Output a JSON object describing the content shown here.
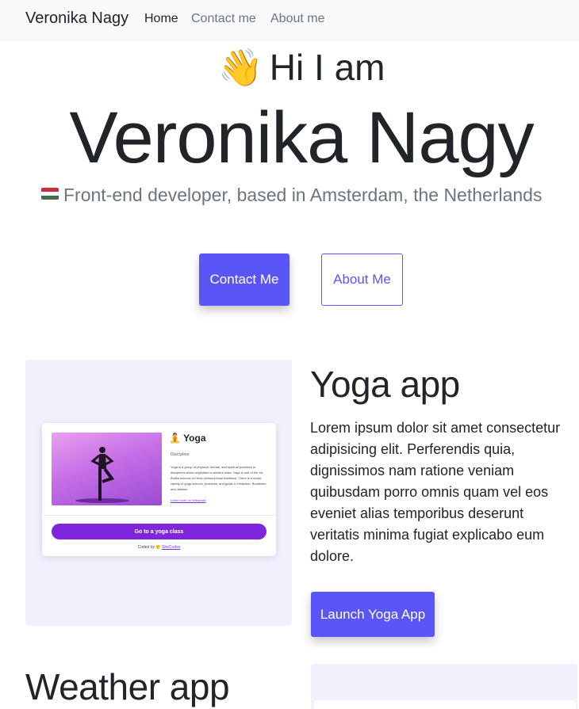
{
  "navbar": {
    "brand": "Veronika Nagy",
    "links": [
      "Home",
      "Contact me",
      "About me"
    ]
  },
  "hero": {
    "greeting": "Hi I am",
    "greeting_emoji": "👋",
    "name": "Veronika Nagy",
    "subtitle": "Front-end developer, based in Amsterdam, the Netherlands",
    "flag_colors": [
      "#cd2a3e",
      "#ffffff",
      "#436f4d"
    ],
    "contact_button": "Contact Me",
    "about_button": "About Me"
  },
  "projects": [
    {
      "title": "Yoga app",
      "description": "Lorem ipsum dolor sit amet consectetur adipisicing elit. Perferendis quia, dignissimos nam ratione veniam quibusdam porro omnis quam vel eos eveniet alias temporibus deserunt veritatis minima fugiat explicabo eum dolore.",
      "button": "Launch Yoga App",
      "preview": {
        "title": "Yoga",
        "subtitle": "Discipline",
        "text": "Yoga is a group of physical, mental, and spiritual practices or disciplines which originated in ancient India. Yoga is one of the six Āstika schools of Hindu philosophical traditions. There is a broad variety of yoga schools, practices, and goals in Hinduism, Buddhism, and Jainism.",
        "link": "Learn more on Wikipedia",
        "button": "Go to a yoga class",
        "credit_prefix": "Coded by 🙂",
        "credit_link": "SheCodes"
      }
    },
    {
      "title": "Weather app"
    }
  ],
  "colors": {
    "accent": "#5a55f7",
    "preview_bg": "#f3f0fe",
    "yoga_purple": "#7f26dc"
  }
}
